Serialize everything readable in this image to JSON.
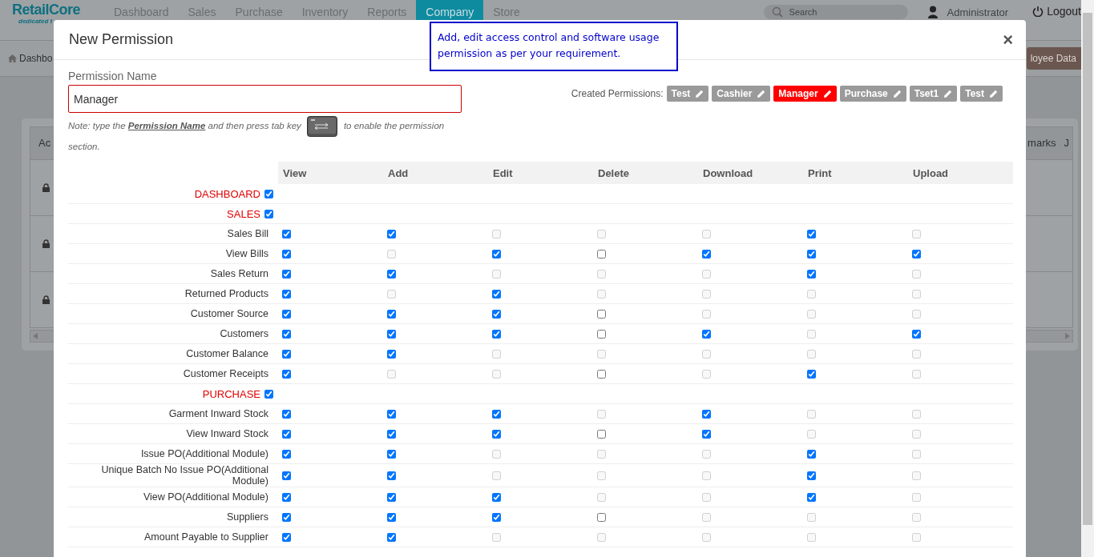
{
  "app": {
    "logo": "RetailCore",
    "tagline": "dedicated t",
    "nav": [
      {
        "label": "Dashboard",
        "selected": false
      },
      {
        "label": "Sales",
        "selected": false
      },
      {
        "label": "Purchase",
        "selected": false
      },
      {
        "label": "Inventory",
        "selected": false
      },
      {
        "label": "Reports",
        "selected": false
      },
      {
        "label": "Company",
        "selected": true
      },
      {
        "label": "Store",
        "selected": false
      }
    ],
    "search": {
      "placeholder": "Search"
    },
    "user": "Administrator",
    "logout": "Logout"
  },
  "breadcrumb": "Dashbo",
  "page_button": "loyee Data",
  "background_table": {
    "columns": [
      "Ac",
      "marks",
      "J"
    ],
    "rows": [
      {
        "locked": true
      },
      {
        "locked": true
      },
      {
        "locked": true
      }
    ]
  },
  "modal": {
    "title": "New Permission",
    "close": "×",
    "hint": "Add, edit access control and software usage permission as per your requirement.",
    "field": {
      "label": "Permission Name",
      "value": "Manager"
    },
    "note": "Note: type the **Permission Name** and then press tab key",
    "note_end": "to enable the permission",
    "note_tail": "section.",
    "created_label": "Created Permissions:",
    "permissions": [
      {
        "label": "Test",
        "selected": false
      },
      {
        "label": "Cashier",
        "selected": false
      },
      {
        "label": "Manager",
        "selected": true
      },
      {
        "label": "Purchase",
        "selected": false
      },
      {
        "label": "Tset1",
        "selected": false
      },
      {
        "label": "Test",
        "selected": false
      }
    ],
    "columns": [
      "View",
      "Add",
      "Edit",
      "Delete",
      "Download",
      "Print",
      "Upload"
    ],
    "rows": [
      {
        "kind": "section",
        "label": "DASHBOARD",
        "checked": true
      },
      {
        "kind": "section",
        "label": "SALES",
        "checked": true
      },
      {
        "kind": "item",
        "label": "Sales Bill",
        "cells": [
          {
            "checked": true,
            "disabled": false
          },
          {
            "checked": true,
            "disabled": false
          },
          {
            "checked": false,
            "disabled": true
          },
          {
            "checked": false,
            "disabled": true
          },
          {
            "checked": false,
            "disabled": true
          },
          {
            "checked": true,
            "disabled": false
          },
          {
            "checked": false,
            "disabled": true
          }
        ]
      },
      {
        "kind": "item",
        "label": "View Bills",
        "cells": [
          {
            "checked": true,
            "disabled": false
          },
          {
            "checked": false,
            "disabled": true
          },
          {
            "checked": true,
            "disabled": false
          },
          {
            "checked": false,
            "disabled": false
          },
          {
            "checked": true,
            "disabled": false
          },
          {
            "checked": true,
            "disabled": false
          },
          {
            "checked": true,
            "disabled": false
          }
        ]
      },
      {
        "kind": "item",
        "label": "Sales Return",
        "cells": [
          {
            "checked": true,
            "disabled": false
          },
          {
            "checked": true,
            "disabled": false
          },
          {
            "checked": false,
            "disabled": true
          },
          {
            "checked": false,
            "disabled": true
          },
          {
            "checked": false,
            "disabled": true
          },
          {
            "checked": true,
            "disabled": false
          },
          {
            "checked": false,
            "disabled": true
          }
        ]
      },
      {
        "kind": "item",
        "label": "Returned Products",
        "cells": [
          {
            "checked": true,
            "disabled": false
          },
          {
            "checked": false,
            "disabled": true
          },
          {
            "checked": true,
            "disabled": false
          },
          {
            "checked": false,
            "disabled": true
          },
          {
            "checked": false,
            "disabled": true
          },
          {
            "checked": false,
            "disabled": true
          },
          {
            "checked": false,
            "disabled": true
          }
        ]
      },
      {
        "kind": "item",
        "label": "Customer Source",
        "cells": [
          {
            "checked": true,
            "disabled": false
          },
          {
            "checked": true,
            "disabled": false
          },
          {
            "checked": true,
            "disabled": false
          },
          {
            "checked": false,
            "disabled": false
          },
          {
            "checked": false,
            "disabled": true
          },
          {
            "checked": false,
            "disabled": true
          },
          {
            "checked": false,
            "disabled": true
          }
        ]
      },
      {
        "kind": "item",
        "label": "Customers",
        "cells": [
          {
            "checked": true,
            "disabled": false
          },
          {
            "checked": true,
            "disabled": false
          },
          {
            "checked": true,
            "disabled": false
          },
          {
            "checked": false,
            "disabled": false
          },
          {
            "checked": true,
            "disabled": false
          },
          {
            "checked": false,
            "disabled": true
          },
          {
            "checked": true,
            "disabled": false
          }
        ]
      },
      {
        "kind": "item",
        "label": "Customer Balance",
        "cells": [
          {
            "checked": true,
            "disabled": false
          },
          {
            "checked": true,
            "disabled": false
          },
          {
            "checked": false,
            "disabled": true
          },
          {
            "checked": false,
            "disabled": true
          },
          {
            "checked": false,
            "disabled": true
          },
          {
            "checked": false,
            "disabled": true
          },
          {
            "checked": false,
            "disabled": true
          }
        ]
      },
      {
        "kind": "item",
        "label": "Customer Receipts",
        "cells": [
          {
            "checked": true,
            "disabled": false
          },
          {
            "checked": false,
            "disabled": true
          },
          {
            "checked": false,
            "disabled": true
          },
          {
            "checked": false,
            "disabled": false
          },
          {
            "checked": false,
            "disabled": true
          },
          {
            "checked": true,
            "disabled": false
          },
          {
            "checked": false,
            "disabled": true
          }
        ]
      },
      {
        "kind": "section",
        "label": "PURCHASE",
        "checked": true
      },
      {
        "kind": "item",
        "label": "Garment Inward Stock",
        "cells": [
          {
            "checked": true,
            "disabled": false
          },
          {
            "checked": true,
            "disabled": false
          },
          {
            "checked": true,
            "disabled": false
          },
          {
            "checked": false,
            "disabled": true
          },
          {
            "checked": true,
            "disabled": false
          },
          {
            "checked": false,
            "disabled": true
          },
          {
            "checked": false,
            "disabled": true
          }
        ]
      },
      {
        "kind": "item",
        "label": "View Inward Stock",
        "cells": [
          {
            "checked": true,
            "disabled": false
          },
          {
            "checked": true,
            "disabled": false
          },
          {
            "checked": true,
            "disabled": false
          },
          {
            "checked": false,
            "disabled": false
          },
          {
            "checked": true,
            "disabled": false
          },
          {
            "checked": false,
            "disabled": true
          },
          {
            "checked": false,
            "disabled": true
          }
        ]
      },
      {
        "kind": "item",
        "label": "Issue PO(Additional Module)",
        "cells": [
          {
            "checked": true,
            "disabled": false
          },
          {
            "checked": true,
            "disabled": false
          },
          {
            "checked": false,
            "disabled": true
          },
          {
            "checked": false,
            "disabled": true
          },
          {
            "checked": false,
            "disabled": true
          },
          {
            "checked": true,
            "disabled": false
          },
          {
            "checked": false,
            "disabled": true
          }
        ]
      },
      {
        "kind": "item",
        "label": "Unique Batch No Issue PO(Additional Module)",
        "cells": [
          {
            "checked": true,
            "disabled": false
          },
          {
            "checked": true,
            "disabled": false
          },
          {
            "checked": false,
            "disabled": true
          },
          {
            "checked": false,
            "disabled": true
          },
          {
            "checked": false,
            "disabled": true
          },
          {
            "checked": true,
            "disabled": false
          },
          {
            "checked": false,
            "disabled": true
          }
        ]
      },
      {
        "kind": "item",
        "label": "View PO(Additional Module)",
        "cells": [
          {
            "checked": true,
            "disabled": false
          },
          {
            "checked": true,
            "disabled": false
          },
          {
            "checked": true,
            "disabled": false
          },
          {
            "checked": false,
            "disabled": true
          },
          {
            "checked": false,
            "disabled": true
          },
          {
            "checked": true,
            "disabled": false
          },
          {
            "checked": false,
            "disabled": true
          }
        ]
      },
      {
        "kind": "item",
        "label": "Suppliers",
        "cells": [
          {
            "checked": true,
            "disabled": false
          },
          {
            "checked": true,
            "disabled": false
          },
          {
            "checked": true,
            "disabled": false
          },
          {
            "checked": false,
            "disabled": false
          },
          {
            "checked": false,
            "disabled": true
          },
          {
            "checked": false,
            "disabled": true
          },
          {
            "checked": false,
            "disabled": true
          }
        ]
      },
      {
        "kind": "item",
        "label": "Amount Payable to Supplier",
        "cells": [
          {
            "checked": true,
            "disabled": false
          },
          {
            "checked": true,
            "disabled": false
          },
          {
            "checked": false,
            "disabled": true
          },
          {
            "checked": false,
            "disabled": true
          },
          {
            "checked": false,
            "disabled": true
          },
          {
            "checked": false,
            "disabled": true
          },
          {
            "checked": false,
            "disabled": true
          }
        ]
      }
    ]
  }
}
